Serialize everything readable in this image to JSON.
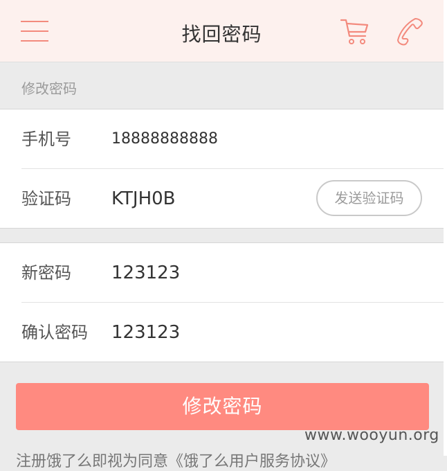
{
  "header": {
    "title": "找回密码",
    "menu_icon": "hamburger-menu-icon",
    "cart_icon": "shopping-cart-icon",
    "phone_icon": "phone-icon",
    "bg_color": "#fdf1ee",
    "accent_color": "#f38a7d"
  },
  "section_label": "修改密码",
  "form": {
    "phone_label": "手机号",
    "phone_value": "18888888888",
    "code_label": "验证码",
    "code_value": "KTJH0B",
    "send_code_label": "发送验证码",
    "new_password_label": "新密码",
    "new_password_value": "123123",
    "confirm_password_label": "确认密码",
    "confirm_password_value": "123123"
  },
  "submit": {
    "label": "修改密码",
    "color": "#ff8a80"
  },
  "notice": "注册饿了么即视为同意《饿了么用户服务协议》",
  "watermark": "www.wooyun.org"
}
